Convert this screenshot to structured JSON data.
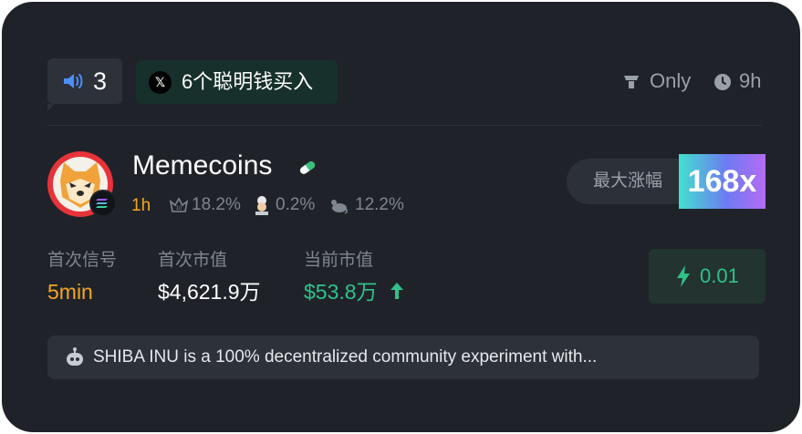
{
  "header": {
    "speaker_count": "3",
    "x_signal_text": "6个聪明钱买入",
    "filter_label": "Only",
    "time_label": "9h"
  },
  "token": {
    "name": "Memecoins",
    "age": "1h",
    "stats": [
      {
        "icon": "crown-icon",
        "value": "18.2%"
      },
      {
        "icon": "chef-icon",
        "value": "0.2%"
      },
      {
        "icon": "rat-icon",
        "value": "12.2%"
      }
    ],
    "max_gain_label": "最大涨幅",
    "max_gain_value": "168x"
  },
  "metrics": {
    "first_signal_label": "首次信号",
    "first_signal_value": "5min",
    "first_mcap_label": "首次市值",
    "first_mcap_value": "$4,621.9万",
    "current_mcap_label": "当前市值",
    "current_mcap_value": "$53.8万"
  },
  "action": {
    "quick_buy_value": "0.01"
  },
  "description": {
    "text": "SHIBA INU is a 100% decentralized community experiment with..."
  },
  "colors": {
    "card_bg": "#1f2329",
    "accent_green": "#2fc28a",
    "accent_orange": "#f5a623",
    "muted_text": "#7f8690"
  }
}
